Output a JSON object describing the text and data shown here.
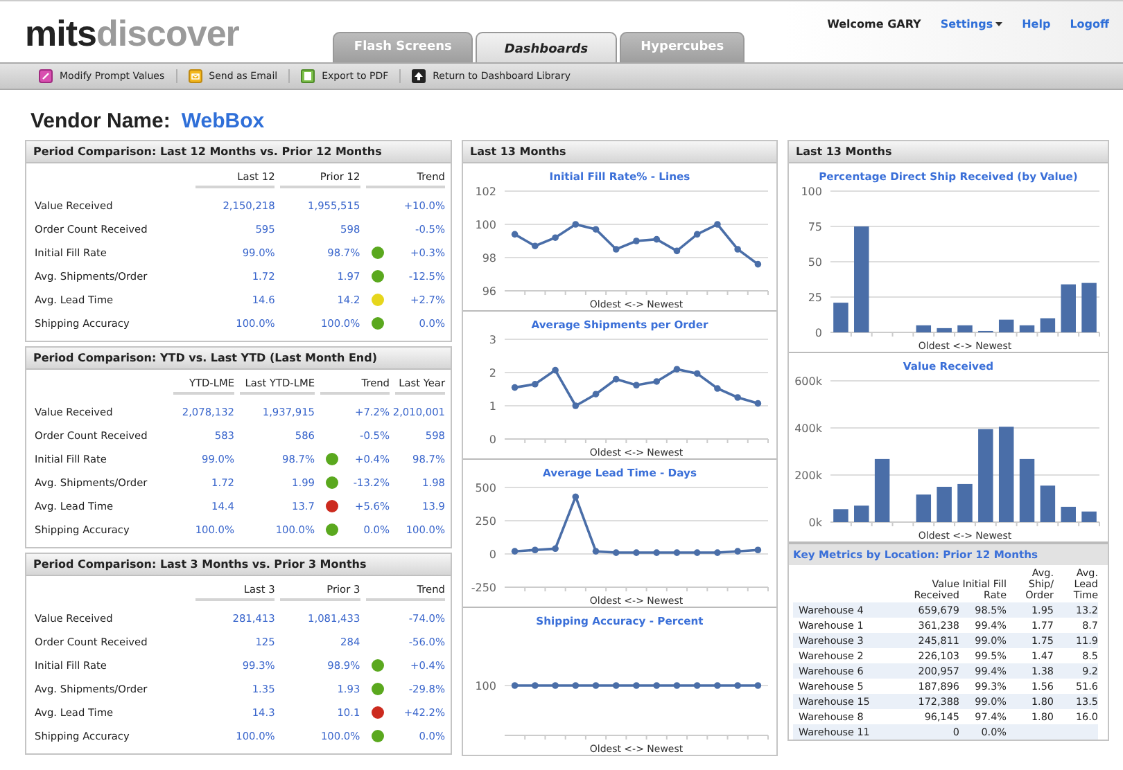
{
  "header": {
    "logo": {
      "part1": "mits",
      "part2": "discover"
    },
    "tabs": [
      {
        "label": "Flash Screens",
        "selected": false
      },
      {
        "label": "Dashboards",
        "selected": true
      },
      {
        "label": "Hypercubes",
        "selected": false
      }
    ],
    "welcome": "Welcome GARY",
    "links": [
      {
        "label": "Settings",
        "dropdown": true
      },
      {
        "label": "Help",
        "dropdown": false
      },
      {
        "label": "Logoff",
        "dropdown": false
      }
    ]
  },
  "toolbar": [
    {
      "label": "Modify Prompt Values"
    },
    {
      "label": "Send as Email"
    },
    {
      "label": "Export to PDF"
    },
    {
      "label": "Return to Dashboard Library"
    }
  ],
  "vendor": {
    "label": "Vendor Name:",
    "value": "WebBox"
  },
  "comparisons": [
    {
      "title": "Period Comparison: Last 12 Months vs. Prior 12 Months",
      "columns": [
        {
          "label": "Last 12",
          "kind": "value"
        },
        {
          "label": "Prior 12",
          "kind": "value"
        },
        {
          "label": "Trend",
          "kind": "trend"
        }
      ],
      "rows": [
        {
          "label": "Value Received",
          "cells": [
            "2,150,218",
            "1,955,515",
            "+10.0%"
          ]
        },
        {
          "label": "Order Count Received",
          "cells": [
            "595",
            "598",
            "-0.5%"
          ]
        },
        {
          "label": "Initial Fill Rate",
          "cells": [
            "99.0%",
            "98.7%",
            "+0.3%"
          ],
          "color": "#5aa81e"
        },
        {
          "label": "Avg. Shipments/Order",
          "cells": [
            "1.72",
            "1.97",
            "-12.5%"
          ],
          "color": "#5aa81e"
        },
        {
          "label": "Avg. Lead Time",
          "cells": [
            "14.6",
            "14.2",
            "+2.7%"
          ],
          "color": "#e6d61c"
        },
        {
          "label": "Shipping Accuracy",
          "cells": [
            "100.0%",
            "100.0%",
            "0.0%"
          ],
          "color": "#5aa81e"
        }
      ]
    },
    {
      "title": "Period Comparison: YTD vs. Last YTD (Last Month End)",
      "columns": [
        {
          "label": "YTD-LME",
          "kind": "value"
        },
        {
          "label": "Last YTD-LME",
          "kind": "value"
        },
        {
          "label": "Trend",
          "kind": "trend"
        },
        {
          "label": "Last Year",
          "kind": "value"
        }
      ],
      "rows": [
        {
          "label": "Value Received",
          "cells": [
            "2,078,132",
            "1,937,915",
            "+7.2%",
            "2,010,001"
          ]
        },
        {
          "label": "Order Count Received",
          "cells": [
            "583",
            "586",
            "-0.5%",
            "598"
          ]
        },
        {
          "label": "Initial Fill Rate",
          "cells": [
            "99.0%",
            "98.7%",
            "+0.4%",
            "98.7%"
          ],
          "color": "#5aa81e"
        },
        {
          "label": "Avg. Shipments/Order",
          "cells": [
            "1.72",
            "1.99",
            "-13.2%",
            "1.98"
          ],
          "color": "#5aa81e"
        },
        {
          "label": "Avg. Lead Time",
          "cells": [
            "14.4",
            "13.7",
            "+5.6%",
            "13.9"
          ],
          "color": "#cc2a1e"
        },
        {
          "label": "Shipping Accuracy",
          "cells": [
            "100.0%",
            "100.0%",
            "0.0%",
            "100.0%"
          ],
          "color": "#5aa81e"
        }
      ]
    },
    {
      "title": "Period Comparison: Last 3 Months vs. Prior 3 Months",
      "columns": [
        {
          "label": "Last 3",
          "kind": "value"
        },
        {
          "label": "Prior 3",
          "kind": "value"
        },
        {
          "label": "Trend",
          "kind": "trend"
        }
      ],
      "rows": [
        {
          "label": "Value Received",
          "cells": [
            "281,413",
            "1,081,433",
            "-74.0%"
          ]
        },
        {
          "label": "Order Count Received",
          "cells": [
            "125",
            "284",
            "-56.0%"
          ]
        },
        {
          "label": "Initial Fill Rate",
          "cells": [
            "99.3%",
            "98.9%",
            "+0.4%"
          ],
          "color": "#5aa81e"
        },
        {
          "label": "Avg. Shipments/Order",
          "cells": [
            "1.35",
            "1.93",
            "-29.8%"
          ],
          "color": "#5aa81e"
        },
        {
          "label": "Avg. Lead Time",
          "cells": [
            "14.3",
            "10.1",
            "+42.2%"
          ],
          "color": "#cc2a1e"
        },
        {
          "label": "Shipping Accuracy",
          "cells": [
            "100.0%",
            "100.0%",
            "0.0%"
          ],
          "color": "#5aa81e"
        }
      ]
    }
  ],
  "trend_panel": {
    "title": "Last 13 Months",
    "charts": [
      {
        "chart_data": {
          "type": "line",
          "title": "Initial Fill Rate% - Lines",
          "xlabel": "Oldest <-> Newest",
          "grid": true,
          "ylim": [
            96,
            102
          ],
          "yticks": [
            96,
            98,
            100,
            102
          ],
          "series": [
            {
              "color": "#4a6ea8",
              "marker": "circle",
              "values": [
                99.4,
                98.7,
                99.2,
                100,
                99.7,
                98.5,
                99.0,
                99.1,
                98.4,
                99.4,
                100,
                98.5,
                97.6
              ]
            }
          ]
        }
      },
      {
        "chart_data": {
          "type": "line",
          "title": "Average Shipments per Order",
          "xlabel": "Oldest <-> Newest",
          "grid": true,
          "ylim": [
            0,
            3
          ],
          "yticks": [
            0,
            1,
            2,
            3
          ],
          "series": [
            {
              "color": "#4a6ea8",
              "marker": "circle",
              "values": [
                1.55,
                1.65,
                2.07,
                1.0,
                1.35,
                1.8,
                1.62,
                1.73,
                2.1,
                1.97,
                1.52,
                1.25,
                1.07
              ]
            }
          ]
        }
      },
      {
        "chart_data": {
          "type": "line",
          "title": "Average Lead Time - Days",
          "xlabel": "Oldest <-> Newest",
          "grid": true,
          "ylim": [
            -250,
            500
          ],
          "yticks": [
            -250,
            0,
            250,
            500
          ],
          "series": [
            {
              "color": "#4a6ea8",
              "marker": "circle",
              "values": [
                20,
                30,
                40,
                430,
                20,
                10,
                10,
                10,
                10,
                10,
                10,
                20,
                30
              ]
            }
          ]
        }
      },
      {
        "kind": "sketch",
        "title": "Shipping Accuracy - Percent",
        "axis_label": "100",
        "xlabel": "Oldest <-> Newest"
      }
    ]
  },
  "bar_panel": {
    "title": "Last 13 Months",
    "charts": [
      {
        "chart_data": {
          "type": "bar",
          "title": "Percentage Direct Ship Received (by Value)",
          "xlabel": "Oldest <-> Newest",
          "grid": true,
          "ylim": [
            0,
            100
          ],
          "yticks": [
            0,
            25,
            50,
            75,
            100
          ],
          "series": [
            {
              "color": "#4a6ea8",
              "values": [
                21,
                75,
                0,
                0,
                5,
                3,
                5,
                1,
                9,
                5,
                10,
                34,
                35
              ]
            }
          ]
        }
      },
      {
        "chart_data": {
          "type": "bar",
          "title": "Value Received",
          "xlabel": "Oldest <-> Newest",
          "ylim": [
            0,
            600000
          ],
          "yticks": [
            {
              "value": 0,
              "label": "0k"
            },
            {
              "value": 200000,
              "label": "200k"
            },
            {
              "value": 400000,
              "label": "400k"
            },
            {
              "value": 600000,
              "label": "600k"
            }
          ],
          "grid": true,
          "series": [
            {
              "color": "#4a6ea8",
              "values": [
                55000,
                70000,
                268000,
                0,
                117000,
                150000,
                162000,
                395000,
                405000,
                268000,
                155000,
                65000,
                45000
              ]
            }
          ]
        }
      }
    ],
    "key_metrics": {
      "title": "Key Metrics by Location: Prior 12 Months",
      "columns": [
        "Value Received",
        "Initial Fill Rate",
        "Avg. Ship/ Order",
        "Avg. Lead Time"
      ],
      "rows": [
        {
          "location": "Warehouse 4",
          "cells": [
            "659,679",
            "98.5%",
            "1.95",
            "13.2"
          ]
        },
        {
          "location": "Warehouse 1",
          "cells": [
            "361,238",
            "99.4%",
            "1.77",
            "8.7"
          ]
        },
        {
          "location": "Warehouse 3",
          "cells": [
            "245,811",
            "99.0%",
            "1.75",
            "11.9"
          ]
        },
        {
          "location": "Warehouse 2",
          "cells": [
            "226,103",
            "99.5%",
            "1.47",
            "8.5"
          ]
        },
        {
          "location": "Warehouse 6",
          "cells": [
            "200,957",
            "99.4%",
            "1.38",
            "9.2"
          ]
        },
        {
          "location": "Warehouse 5",
          "cells": [
            "187,896",
            "99.3%",
            "1.56",
            "51.6"
          ]
        },
        {
          "location": "Warehouse 15",
          "cells": [
            "172,388",
            "99.0%",
            "1.80",
            "13.5"
          ]
        },
        {
          "location": "Warehouse 8",
          "cells": [
            "96,145",
            "97.4%",
            "1.80",
            "16.0"
          ]
        },
        {
          "location": "Warehouse 11",
          "cells": [
            "0",
            "0.0%"
          ]
        }
      ]
    }
  }
}
